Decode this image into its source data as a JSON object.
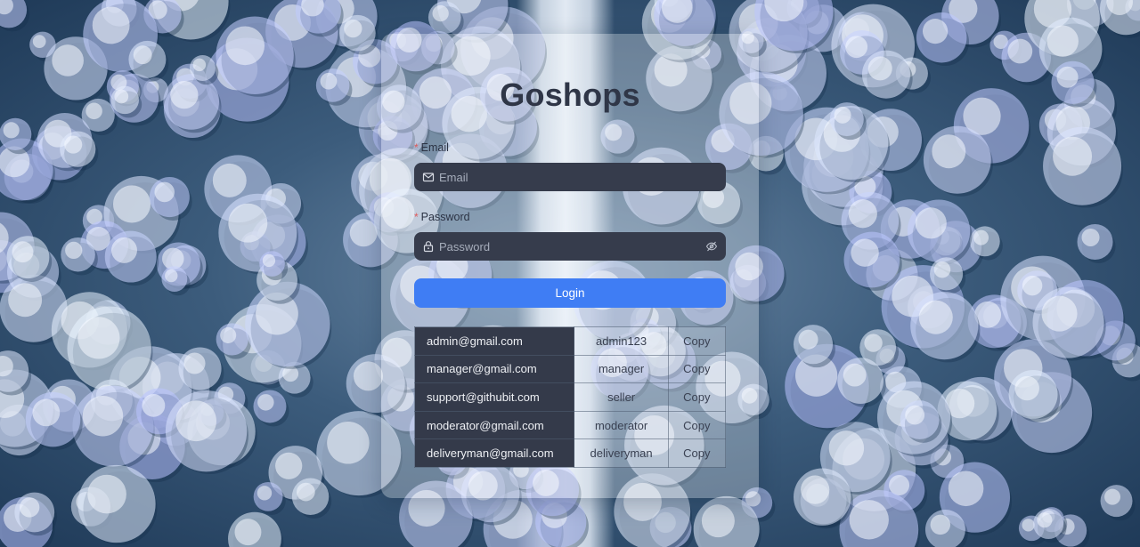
{
  "app": {
    "title": "Goshops"
  },
  "form": {
    "email_label": "Email",
    "email_placeholder": "Email",
    "email_value": "",
    "password_label": "Password",
    "password_placeholder": "Password",
    "password_value": "",
    "login_label": "Login",
    "required_marker": "*"
  },
  "icons": {
    "email": "mail-icon",
    "password": "lock-icon",
    "visibility": "eye-off-icon"
  },
  "credentials": [
    {
      "email": "admin@gmail.com",
      "password": "admin123",
      "action": "Copy"
    },
    {
      "email": "manager@gmail.com",
      "password": "manager",
      "action": "Copy"
    },
    {
      "email": "support@githubit.com",
      "password": "seller",
      "action": "Copy"
    },
    {
      "email": "moderator@gmail.com",
      "password": "moderator",
      "action": "Copy"
    },
    {
      "email": "deliveryman@gmail.com",
      "password": "deliveryman",
      "action": "Copy"
    }
  ],
  "colors": {
    "accent": "#3f7df4",
    "input_bg": "#363c4c",
    "title": "#2f3647",
    "required": "#e05a5a"
  }
}
